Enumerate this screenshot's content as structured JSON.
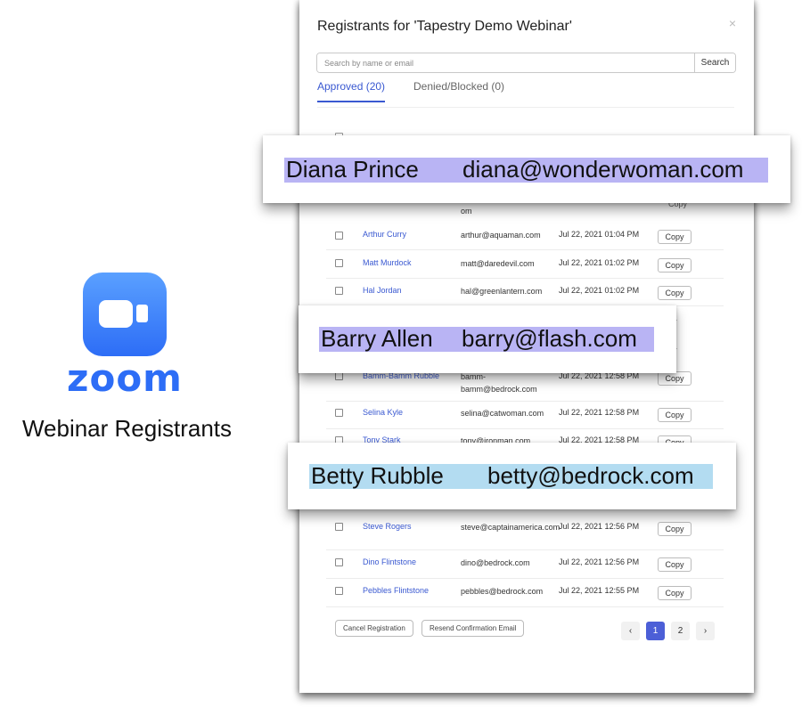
{
  "brand": {
    "icon": "zoom-camera-icon",
    "wordmark": "zoom",
    "subtitle": "Webinar Registrants",
    "color": "#2d6df6"
  },
  "dialog": {
    "title": "Registrants for 'Tapestry Demo Webinar'",
    "close_icon": "×",
    "search": {
      "placeholder": "Search by name or email",
      "button": "Search"
    },
    "tabs": [
      {
        "label": "Approved (20)",
        "active": true
      },
      {
        "label": "Denied/Blocked (0)",
        "active": false
      }
    ],
    "rows": [
      {
        "name": "Arthur Curry",
        "email": "arthur@aquaman.com",
        "date": "Jul 22, 2021 01:04 PM",
        "copy": "Copy"
      },
      {
        "name": "Matt Murdock",
        "email": "matt@daredevil.com",
        "date": "Jul 22, 2021 01:02 PM",
        "copy": "Copy"
      },
      {
        "name": "Hal Jordan",
        "email": "hal@greenlantern.com",
        "date": "Jul 22, 2021 01:02 PM",
        "copy": "Copy"
      },
      {
        "name": "Bamm-Bamm Rubble",
        "email": "bamm-bamm@bedrock.com",
        "date": "Jul 22, 2021 12:58 PM",
        "copy": "Copy"
      },
      {
        "name": "Selina Kyle",
        "email": "selina@catwoman.com",
        "date": "Jul 22, 2021 12:58 PM",
        "copy": "Copy"
      },
      {
        "name": "Tony Stark",
        "email": "tony@ironman.com",
        "date": "Jul 22, 2021 12:58 PM",
        "copy": "Copy"
      },
      {
        "name": "Steve Rogers",
        "email": "steve@captainamerica.com",
        "date": "Jul 22, 2021 12:56 PM",
        "copy": "Copy"
      },
      {
        "name": "Dino Flintstone",
        "email": "dino@bedrock.com",
        "date": "Jul 22, 2021 12:56 PM",
        "copy": "Copy"
      },
      {
        "name": "Pebbles Flintstone",
        "email": "pebbles@bedrock.com",
        "date": "Jul 22, 2021 12:55 PM",
        "copy": "Copy"
      }
    ],
    "fragments": {
      "email_tail": "om",
      "copy_top": "Copy",
      "copy_partial": "py"
    },
    "footer": {
      "cancel": "Cancel Registration",
      "resend": "Resend Confirmation Email",
      "prev": "‹",
      "pages": [
        "1",
        "2"
      ],
      "next": "›",
      "current_page": 1
    }
  },
  "highlights": [
    {
      "name": "Diana Prince",
      "email": "diana@wonderwoman.com",
      "color": "#b9b4f4"
    },
    {
      "name": "Barry Allen",
      "email": "barry@flash.com",
      "color": "#b9b4f4"
    },
    {
      "name": "Betty Rubble",
      "email": "betty@bedrock.com",
      "color": "#b3dcf1"
    }
  ]
}
